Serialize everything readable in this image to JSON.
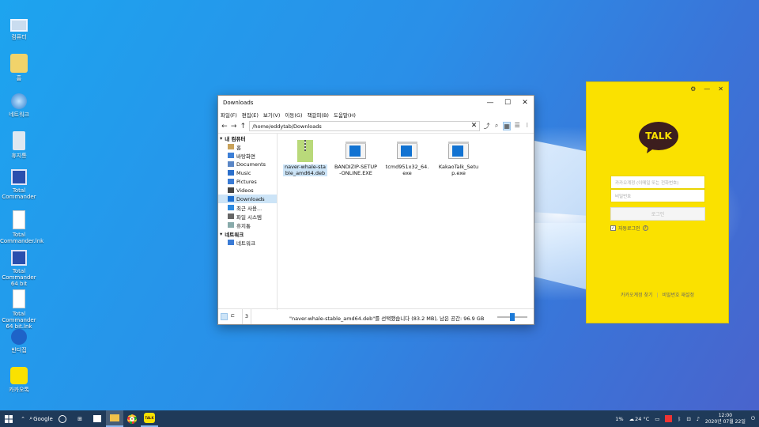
{
  "desktop": {
    "icons": [
      {
        "label": "컴퓨터",
        "icon": "computer-icon"
      },
      {
        "label": "홈",
        "icon": "home-user-icon"
      },
      {
        "label": "네트워크",
        "icon": "network-globe-icon"
      },
      {
        "label": "휴지통",
        "icon": "trash-icon"
      },
      {
        "label": "Total Commander",
        "icon": "floppy-icon"
      },
      {
        "label": "Total Commander.lnk",
        "icon": "document-icon"
      },
      {
        "label": "Total Commander 64 bit",
        "icon": "floppy-icon"
      },
      {
        "label": "Total Commander 64 bit.lnk",
        "icon": "document-icon"
      },
      {
        "label": "반디집",
        "icon": "bandizip-icon"
      },
      {
        "label": "카카오톡",
        "icon": "kakaotalk-icon"
      }
    ]
  },
  "explorer": {
    "title": "Downloads",
    "menu": [
      "파일(F)",
      "편집(E)",
      "보기(V)",
      "이동(G)",
      "책갈피(B)",
      "도움말(H)"
    ],
    "path": "/home/eddytab/Downloads",
    "sidebar": [
      {
        "label": "내 컴퓨터",
        "head": true
      },
      {
        "label": "홈"
      },
      {
        "label": "바탕화면"
      },
      {
        "label": "Documents"
      },
      {
        "label": "Music"
      },
      {
        "label": "Pictures"
      },
      {
        "label": "Videos"
      },
      {
        "label": "Downloads",
        "selected": true
      },
      {
        "label": "최근 사용..."
      },
      {
        "label": "파일 시스템"
      },
      {
        "label": "휴지통"
      },
      {
        "label": "네트워크",
        "head": true
      },
      {
        "label": "네트워크"
      }
    ],
    "files": [
      {
        "name": "naver-whale-stable_amd64.deb",
        "type": "archive",
        "selected": true
      },
      {
        "name": "BANDIZIP-SETUP-ONLINE.EXE",
        "type": "exe"
      },
      {
        "name": "tcmd951x32_64.exe",
        "type": "exe"
      },
      {
        "name": "KakaoTalk_Setup.exe",
        "type": "exe"
      }
    ],
    "status": {
      "message": "\"naver-whale-stable_amd64.deb\"를 선택했습니다 (83.2 MB), 남은 공간: 96.9 GB",
      "count": "3"
    }
  },
  "kakao": {
    "logo": "TALK",
    "id_placeholder": "카카오계정 (이메일 또는 전화번호)",
    "pw_placeholder": "비밀번호",
    "login": "로그인",
    "auto_login": "자동로그인",
    "find_account": "카카오계정 찾기",
    "reset_password": "비밀번호 재설정",
    "colors": {
      "bg": "#fae100",
      "bubble": "#3c1e1e"
    }
  },
  "taskbar": {
    "search": "Google",
    "battery": "1%",
    "weather": "24 °C",
    "time": "12:00",
    "date": "2020년 07월 22일"
  }
}
